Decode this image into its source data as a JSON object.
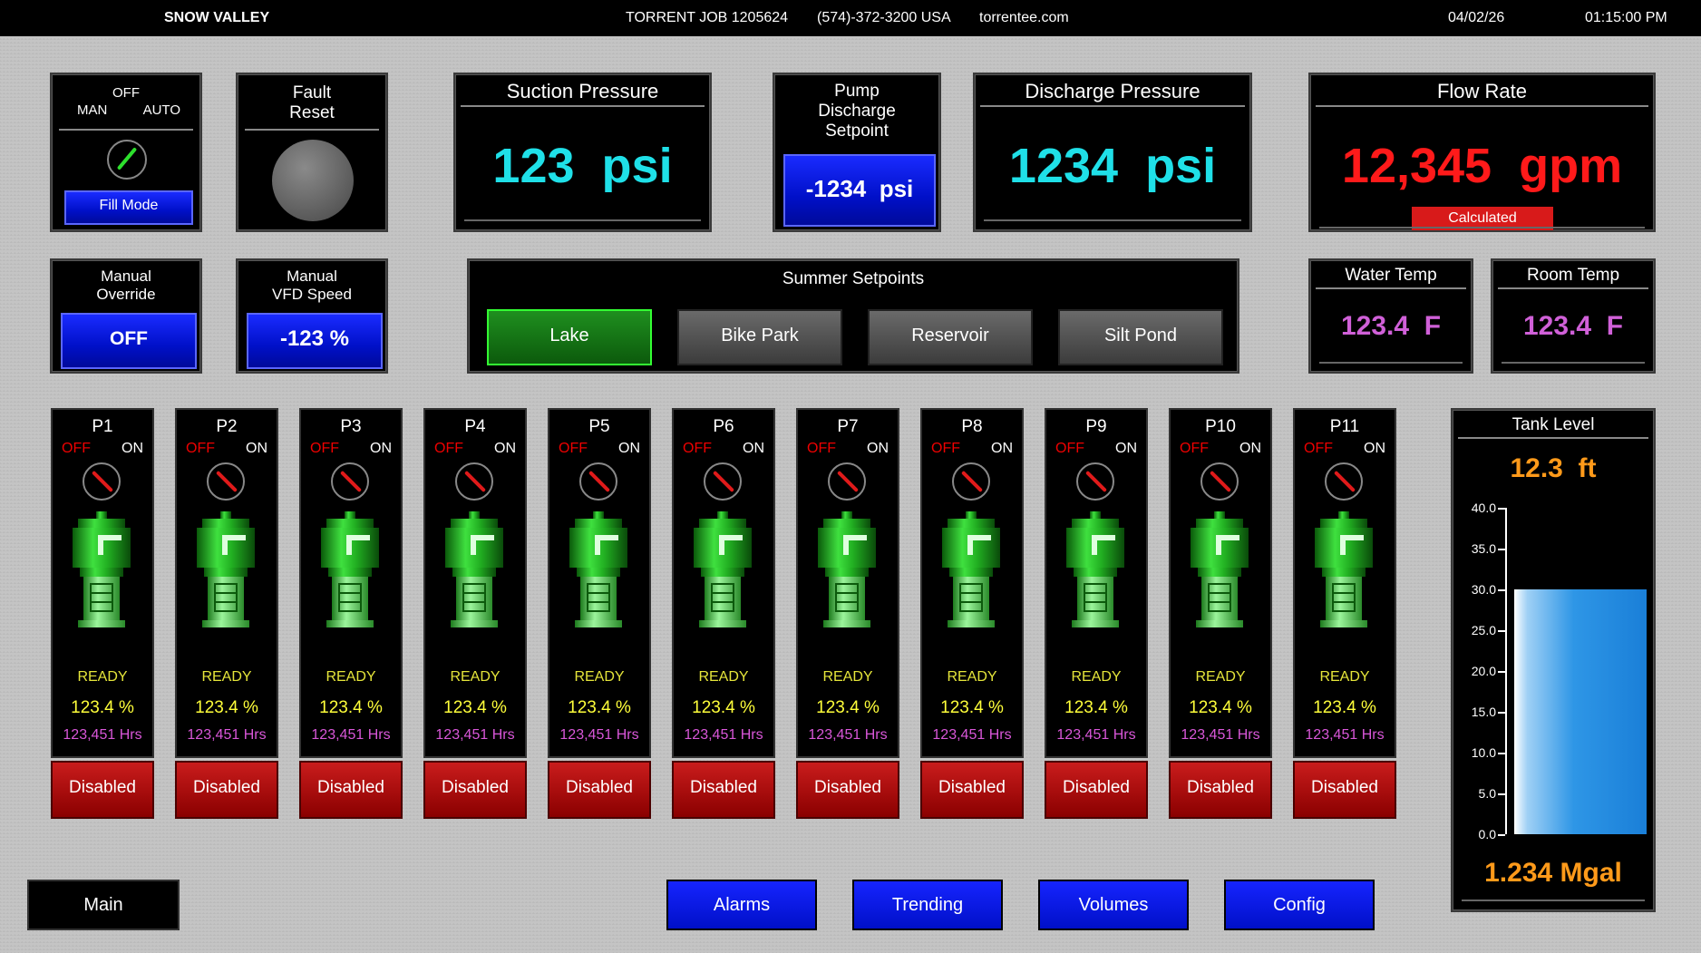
{
  "header": {
    "site": "SNOW VALLEY",
    "job": "TORRENT JOB 1205624",
    "phone": "(574)-372-3200 USA",
    "website": "torrentee.com",
    "date": "04/02/26",
    "time": "01:15:00 PM"
  },
  "mode_selector": {
    "off_label": "OFF",
    "man_label": "MAN",
    "auto_label": "AUTO",
    "mode_button": "Fill Mode"
  },
  "fault_reset": {
    "title_line1": "Fault",
    "title_line2": "Reset"
  },
  "suction": {
    "title": "Suction Pressure",
    "value": "123",
    "unit": "psi",
    "color": "#1fe0e8"
  },
  "pump_setpoint": {
    "title_line1": "Pump",
    "title_line2": "Discharge",
    "title_line3": "Setpoint",
    "value": "-1234",
    "unit": "psi"
  },
  "discharge": {
    "title": "Discharge Pressure",
    "value": "1234",
    "unit": "psi",
    "color": "#1fe0e8"
  },
  "flow": {
    "title": "Flow Rate",
    "value": "12,345",
    "unit": "gpm",
    "badge": "Calculated",
    "color": "#ff1a1a"
  },
  "manual_override": {
    "title_line1": "Manual",
    "title_line2": "Override",
    "value": "OFF"
  },
  "manual_vfd": {
    "title_line1": "Manual",
    "title_line2": "VFD Speed",
    "value": "-123 %"
  },
  "summer_setpoints": {
    "title": "Summer Setpoints",
    "buttons": [
      "Lake",
      "Bike Park",
      "Reservoir",
      "Silt Pond"
    ],
    "active": "Lake"
  },
  "water_temp": {
    "title": "Water Temp",
    "value": "123.4",
    "unit": "F",
    "color": "#d060d8"
  },
  "room_temp": {
    "title": "Room Temp",
    "value": "123.4",
    "unit": "F",
    "color": "#d060d8"
  },
  "pumps": [
    {
      "name": "P1",
      "off": "OFF",
      "on": "ON",
      "status": "READY",
      "speed": "123.4 %",
      "hours": "123,451 Hrs",
      "button": "Disabled"
    },
    {
      "name": "P2",
      "off": "OFF",
      "on": "ON",
      "status": "READY",
      "speed": "123.4 %",
      "hours": "123,451 Hrs",
      "button": "Disabled"
    },
    {
      "name": "P3",
      "off": "OFF",
      "on": "ON",
      "status": "READY",
      "speed": "123.4 %",
      "hours": "123,451 Hrs",
      "button": "Disabled"
    },
    {
      "name": "P4",
      "off": "OFF",
      "on": "ON",
      "status": "READY",
      "speed": "123.4 %",
      "hours": "123,451 Hrs",
      "button": "Disabled"
    },
    {
      "name": "P5",
      "off": "OFF",
      "on": "ON",
      "status": "READY",
      "speed": "123.4 %",
      "hours": "123,451 Hrs",
      "button": "Disabled"
    },
    {
      "name": "P6",
      "off": "OFF",
      "on": "ON",
      "status": "READY",
      "speed": "123.4 %",
      "hours": "123,451 Hrs",
      "button": "Disabled"
    },
    {
      "name": "P7",
      "off": "OFF",
      "on": "ON",
      "status": "READY",
      "speed": "123.4 %",
      "hours": "123,451 Hrs",
      "button": "Disabled"
    },
    {
      "name": "P8",
      "off": "OFF",
      "on": "ON",
      "status": "READY",
      "speed": "123.4 %",
      "hours": "123,451 Hrs",
      "button": "Disabled"
    },
    {
      "name": "P9",
      "off": "OFF",
      "on": "ON",
      "status": "READY",
      "speed": "123.4 %",
      "hours": "123,451 Hrs",
      "button": "Disabled"
    },
    {
      "name": "P10",
      "off": "OFF",
      "on": "ON",
      "status": "READY",
      "speed": "123.4 %",
      "hours": "123,451 Hrs",
      "button": "Disabled"
    },
    {
      "name": "P11",
      "off": "OFF",
      "on": "ON",
      "status": "READY",
      "speed": "123.4 %",
      "hours": "123,451 Hrs",
      "button": "Disabled"
    }
  ],
  "tank": {
    "title": "Tank Level",
    "level_value": "12.3",
    "level_unit": "ft",
    "level": 30,
    "volume": "1.234 Mgal",
    "scale_min": 0,
    "scale_max": 40,
    "ticks": [
      "40.0",
      "35.0",
      "30.0",
      "25.0",
      "20.0",
      "15.0",
      "10.0",
      "5.0",
      "0.0"
    ]
  },
  "nav": {
    "main": "Main",
    "alarms": "Alarms",
    "trending": "Trending",
    "volumes": "Volumes",
    "config": "Config"
  },
  "colors": {
    "cyan_value": "#1fe0e8",
    "red_value": "#ff1a1a",
    "orange_value": "#ff9a1a",
    "ready": "#e5e53a",
    "hours": "#d957d9",
    "tank_fill": "#1a8fe8"
  },
  "icons": {
    "mode_knob": "selector-switch-knob-icon",
    "fault_reset": "round-pushbutton-icon",
    "pump": "vertical-pump-icon"
  }
}
